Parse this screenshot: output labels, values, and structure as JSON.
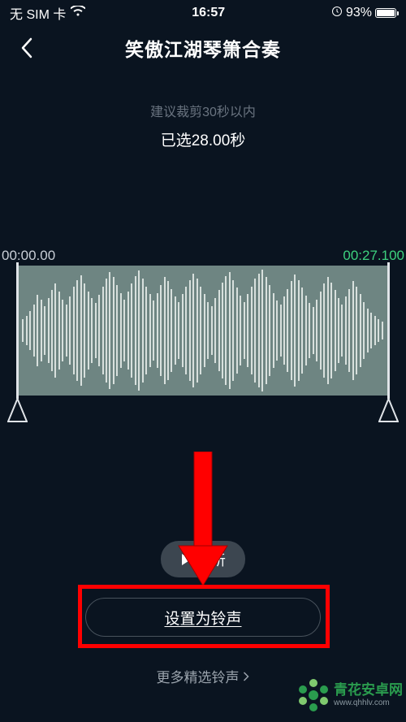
{
  "status": {
    "carrier": "无 SIM 卡",
    "time": "16:57",
    "battery_pct": "93%"
  },
  "nav": {
    "title": "笑傲江湖琴箫合奏"
  },
  "editor": {
    "hint": "建议裁剪30秒以内",
    "selected_label": "已选28.00秒",
    "start_time": "00:00.00",
    "end_time": "00:27.100"
  },
  "buttons": {
    "preview": "试听",
    "set_ringtone": "设置为铃声",
    "more": "更多精选铃声"
  },
  "watermark": {
    "brand": "青花安卓网",
    "url": "www.qhhlv.com"
  }
}
